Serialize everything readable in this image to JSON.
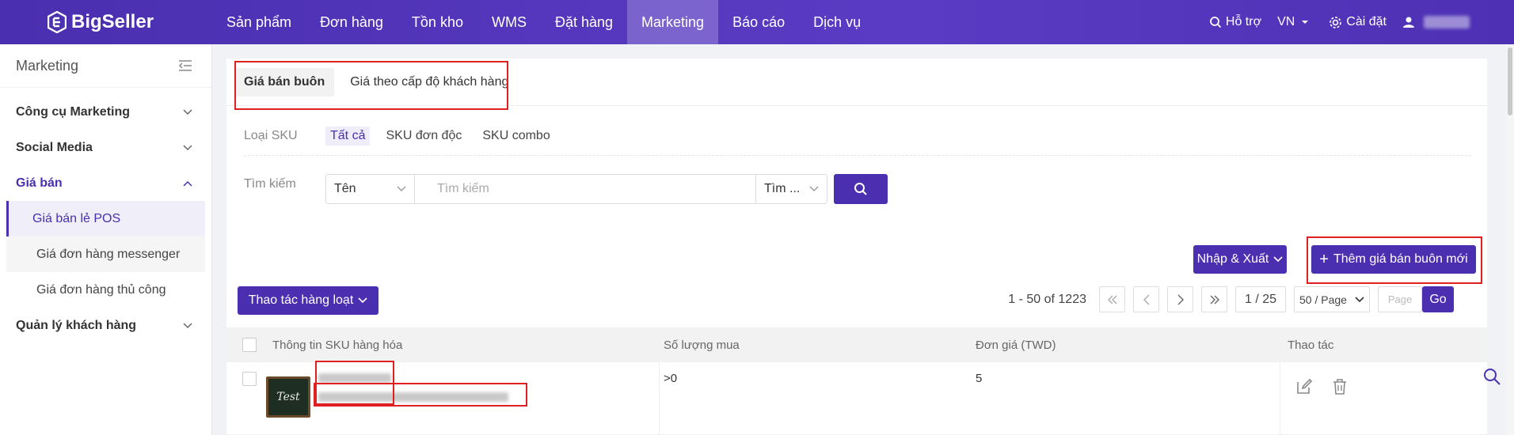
{
  "brand": {
    "name": "BigSeller",
    "accent": "#4b2fb1",
    "alert": "#e02020"
  },
  "nav": {
    "items": [
      {
        "label": "Sản phẩm"
      },
      {
        "label": "Đơn hàng"
      },
      {
        "label": "Tồn kho"
      },
      {
        "label": "WMS"
      },
      {
        "label": "Đặt hàng"
      },
      {
        "label": "Marketing",
        "active": true
      },
      {
        "label": "Báo cáo"
      },
      {
        "label": "Dịch vụ"
      }
    ],
    "support": "Hỗ trợ",
    "language": "VN",
    "settings": "Cài đặt"
  },
  "sidebar": {
    "title": "Marketing",
    "groups": [
      {
        "label": "Công cụ Marketing"
      },
      {
        "label": "Social Media"
      },
      {
        "label": "Giá bán",
        "expanded": true
      }
    ],
    "sub_items": [
      {
        "label": "Giá bán lẻ POS",
        "active": true
      },
      {
        "label": "Giá đơn hàng messenger"
      },
      {
        "label": "Giá đơn hàng thủ công"
      }
    ],
    "last_group": "Quản lý khách hàng"
  },
  "tabs": [
    {
      "label": "Giá bán buôn",
      "active": true
    },
    {
      "label": "Giá theo cấp độ khách hàng"
    }
  ],
  "filters": {
    "sku_type_label": "Loại SKU",
    "sku_types": [
      {
        "label": "Tất cả",
        "active": true
      },
      {
        "label": "SKU đơn độc"
      },
      {
        "label": "SKU combo"
      }
    ],
    "search_label": "Tìm kiếm",
    "search_field": "Tên",
    "search_placeholder": "Tìm kiếm",
    "search_mode": "Tìm ..."
  },
  "actions": {
    "import_export": "Nhập & Xuất",
    "add_new": "Thêm giá bán buôn mới",
    "bulk": "Thao tác hàng loạt"
  },
  "pagination": {
    "summary": "1 - 50 of 1223",
    "page": "1 / 25",
    "page_size": "50 / Page",
    "goto_placeholder": "Page",
    "go": "Go"
  },
  "table": {
    "columns": [
      "Thông tin SKU hàng hóa",
      "Số lượng mua",
      "Đơn giá (TWD)",
      "Thao tác"
    ],
    "rows": [
      {
        "thumb_text": "Test",
        "quantity": ">0",
        "price": "5"
      }
    ]
  }
}
